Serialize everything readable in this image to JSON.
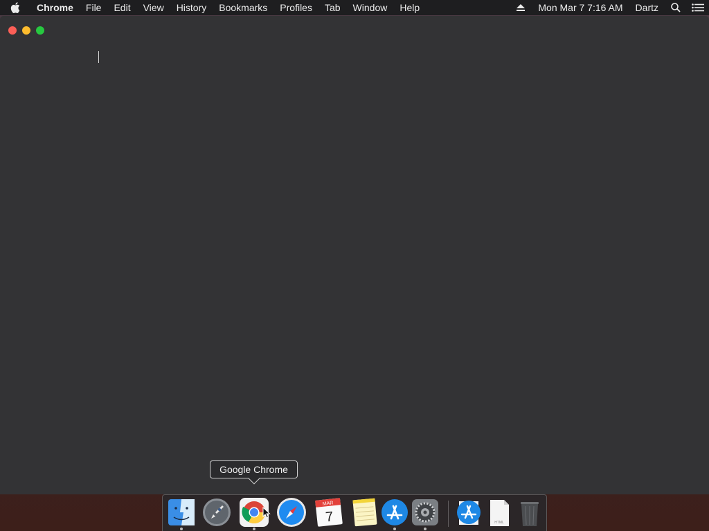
{
  "menubar": {
    "app_name": "Chrome",
    "items": [
      "File",
      "Edit",
      "View",
      "History",
      "Bookmarks",
      "Profiles",
      "Tab",
      "Window",
      "Help"
    ],
    "datetime": "Mon Mar 7  7:16 AM",
    "user": "Dartz",
    "icons": [
      "apple-icon",
      "eject-icon",
      "search-icon",
      "list-icon"
    ]
  },
  "window": {
    "traffic_lights": [
      "close",
      "minimize",
      "zoom"
    ],
    "colors": {
      "close": "#fc5f57",
      "minimize": "#fdbc2e",
      "zoom": "#27c840",
      "background": "#333335"
    }
  },
  "tooltip": {
    "text": "Google Chrome"
  },
  "dock": {
    "items": [
      {
        "name": "Finder",
        "icon": "finder-icon",
        "running": true
      },
      {
        "name": "Launchpad",
        "icon": "launchpad-icon",
        "running": false
      },
      {
        "name": "Google Chrome",
        "icon": "chrome-icon",
        "running": true
      },
      {
        "name": "Safari",
        "icon": "safari-icon",
        "running": false
      },
      {
        "name": "Calendar",
        "icon": "calendar-icon",
        "running": false,
        "month": "MAR",
        "day": "7"
      },
      {
        "name": "Notes",
        "icon": "notes-icon",
        "running": false
      },
      {
        "name": "App Store",
        "icon": "app-store-icon",
        "running": true
      },
      {
        "name": "System Preferences",
        "icon": "gear-icon",
        "running": true
      },
      {
        "name": "Downloads",
        "icon": "app-store-download-icon",
        "running": false
      },
      {
        "name": "Document",
        "icon": "file-icon",
        "running": false,
        "label": "HTML"
      },
      {
        "name": "Trash",
        "icon": "trash-icon",
        "running": false
      }
    ]
  }
}
